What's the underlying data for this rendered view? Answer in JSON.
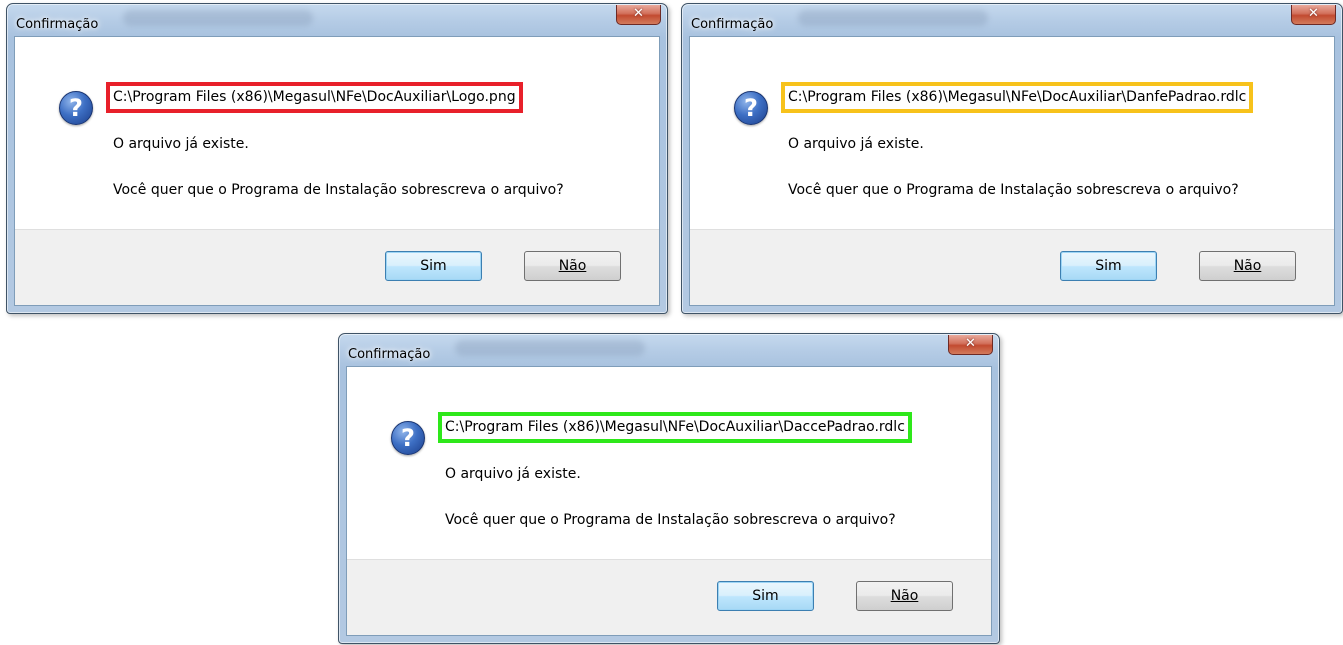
{
  "dialogs": [
    {
      "title": "Confirmação",
      "path": "C:\\Program Files (x86)\\Megasul\\NFe\\DocAuxiliar\\Logo.png",
      "highlight_color": "#e8202a",
      "message_exists": "O arquivo já existe.",
      "message_question": "Você quer que o Programa de Instalação sobrescreva o arquivo?",
      "yes_label": "Sim",
      "no_label": "Não"
    },
    {
      "title": "Confirmação",
      "path": "C:\\Program Files (x86)\\Megasul\\NFe\\DocAuxiliar\\DanfePadrao.rdlc",
      "highlight_color": "#f7c21b",
      "message_exists": "O arquivo já existe.",
      "message_question": "Você quer que o Programa de Instalação sobrescreva o arquivo?",
      "yes_label": "Sim",
      "no_label": "Não"
    },
    {
      "title": "Confirmação",
      "path": "C:\\Program Files (x86)\\Megasul\\NFe\\DocAuxiliar\\DaccePadrao.rdlc",
      "highlight_color": "#2ee81a",
      "message_exists": "O arquivo já existe.",
      "message_question": "Você quer que o Programa de Instalação sobrescreva o arquivo?",
      "yes_label": "Sim",
      "no_label": "Não"
    }
  ],
  "icons": {
    "close": "close-icon",
    "question": "question-icon"
  }
}
